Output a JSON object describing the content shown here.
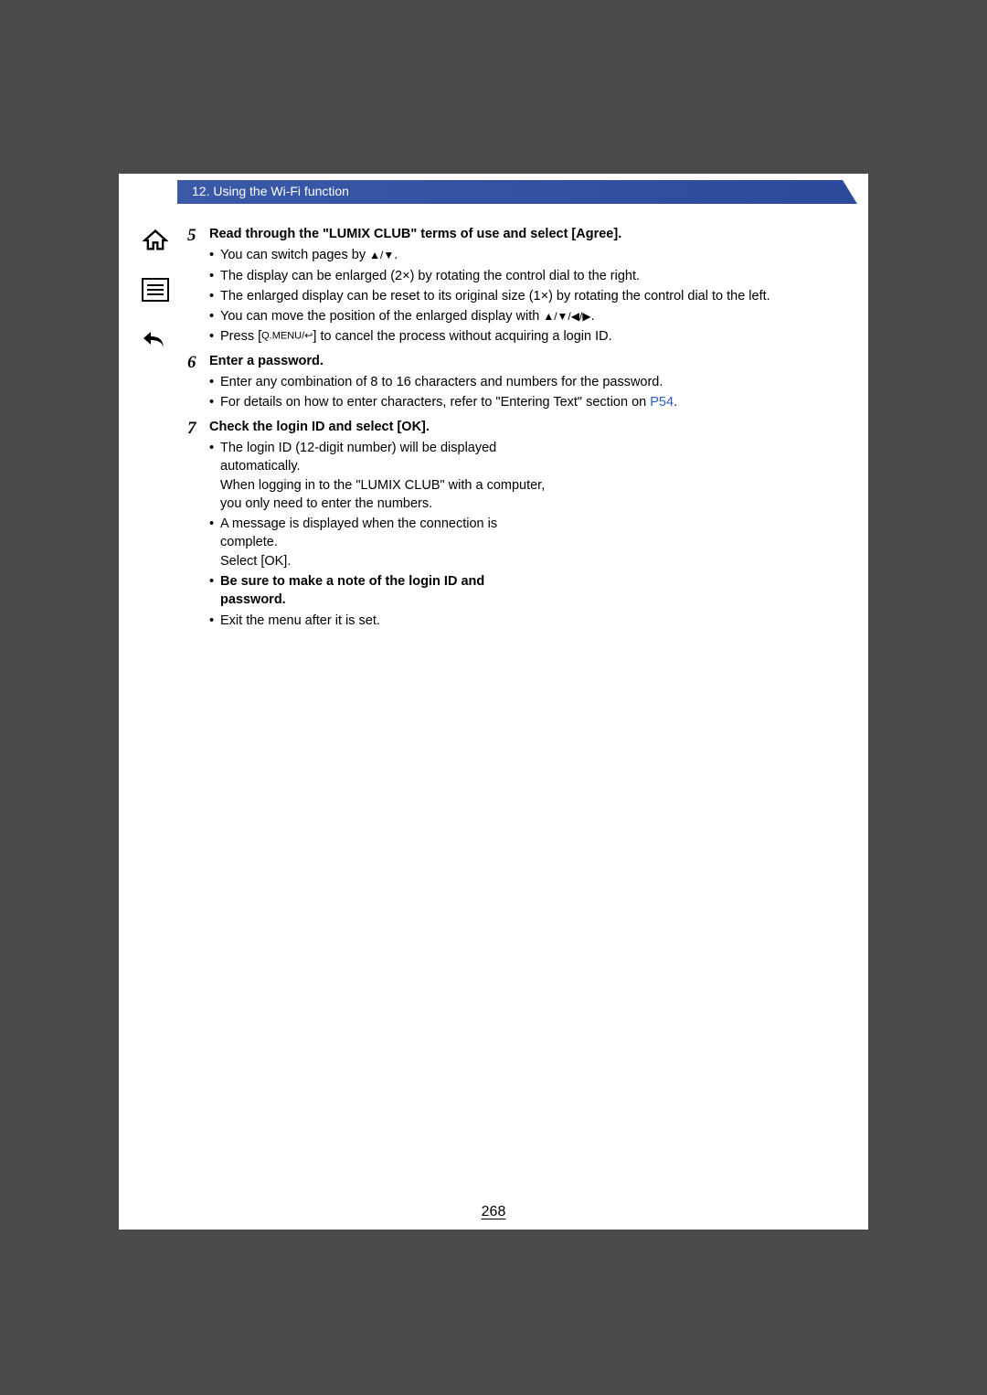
{
  "header": {
    "chapter": "12. Using the Wi-Fi function"
  },
  "nav": {
    "home": "home-icon",
    "toc": "toc-icon",
    "back": "back-icon"
  },
  "steps": [
    {
      "num": "5",
      "title": "Read through the \"LUMIX CLUB\" terms of use and select [Agree].",
      "bullets": [
        {
          "pre": "You can switch pages by ",
          "sym": "▲/▼",
          "post": "."
        },
        {
          "text": "The display can be enlarged  (2×)  by rotating the control dial to the right."
        },
        {
          "text": "The enlarged display can be reset to its original size  (1×)  by rotating the control dial to the left."
        },
        {
          "pre": "You can move the position of the enlarged display with ",
          "sym": "▲/▼/◀/▶",
          "post": "."
        },
        {
          "press": "Press [",
          "btn": "Q.MENU/↩",
          "post2": "] to cancel the process without acquiring a login ID."
        }
      ]
    },
    {
      "num": "6",
      "title": "Enter a password.",
      "bullets": [
        {
          "text": "Enter any combination of 8 to 16 characters and numbers for the password."
        },
        {
          "pre": "For details on how to enter characters, refer to \"Entering Text\" section on ",
          "link": "P54",
          "post": "."
        }
      ]
    },
    {
      "num": "7",
      "title": "Check the login ID and select [OK].",
      "bullets": [
        {
          "multiline": [
            "The login ID (12-digit number) will be displayed automatically.",
            "When logging in to the \"LUMIX CLUB\" with a computer, you only need to enter the numbers."
          ]
        },
        {
          "multiline": [
            "A message is displayed when the connection is complete.",
            "Select [OK]."
          ]
        },
        {
          "bold": "Be sure to make a note of the login ID and password."
        },
        {
          "text": "Exit the menu after it is set."
        }
      ]
    }
  ],
  "page_number": "268"
}
